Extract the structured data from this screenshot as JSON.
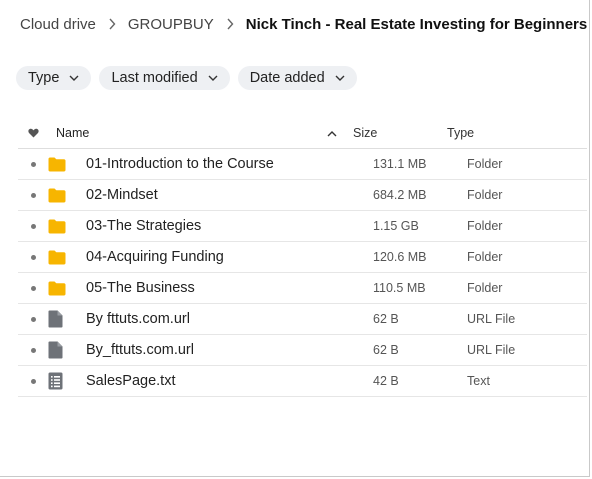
{
  "breadcrumb": {
    "items": [
      "Cloud drive",
      "GROUPBUY"
    ],
    "current": "Nick Tinch - Real Estate Investing for Beginners"
  },
  "filters": [
    "Type",
    "Last modified",
    "Date added"
  ],
  "table": {
    "headers": {
      "name": "Name",
      "size": "Size",
      "type": "Type"
    },
    "rows": [
      {
        "name": "01-Introduction to the Course",
        "size": "131.1 MB",
        "type": "Folder",
        "icon": "folder-icon"
      },
      {
        "name": "02-Mindset",
        "size": "684.2 MB",
        "type": "Folder",
        "icon": "folder-icon"
      },
      {
        "name": "03-The Strategies",
        "size": "1.15 GB",
        "type": "Folder",
        "icon": "folder-icon"
      },
      {
        "name": "04-Acquiring Funding",
        "size": "120.6 MB",
        "type": "Folder",
        "icon": "folder-icon"
      },
      {
        "name": "05-The Business",
        "size": "110.5 MB",
        "type": "Folder",
        "icon": "folder-icon"
      },
      {
        "name": "By fttuts.com.url",
        "size": "62 B",
        "type": "URL File",
        "icon": "generic-file-icon"
      },
      {
        "name": "By_fttuts.com.url",
        "size": "62 B",
        "type": "URL File",
        "icon": "generic-file-icon"
      },
      {
        "name": "SalesPage.txt",
        "size": "42 B",
        "type": "Text",
        "icon": "text-file-icon"
      }
    ]
  },
  "colors": {
    "folder": "#f7b500",
    "file": "#6e7278",
    "chip_bg": "#eef0f3"
  }
}
